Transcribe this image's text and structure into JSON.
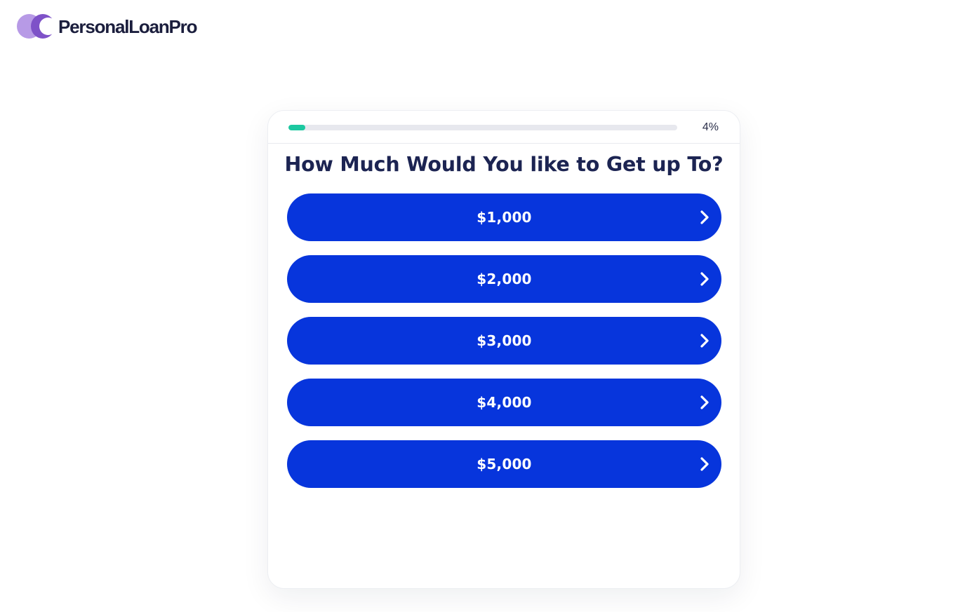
{
  "brand": {
    "name": "PersonalLoanPro",
    "logo_colors": [
      "#b79ae6",
      "#7e52c8"
    ]
  },
  "progress": {
    "percent": 4,
    "label": "4%",
    "color": "#1cc8a0"
  },
  "question": "How Much Would You like to Get up To?",
  "options": [
    {
      "label": "$1,000"
    },
    {
      "label": "$2,000"
    },
    {
      "label": "$3,000"
    },
    {
      "label": "$4,000"
    },
    {
      "label": "$5,000"
    }
  ],
  "colors": {
    "button": "#0735dc",
    "heading": "#1c2452"
  },
  "icons": {
    "option_arrow": "chevron-right-icon"
  }
}
